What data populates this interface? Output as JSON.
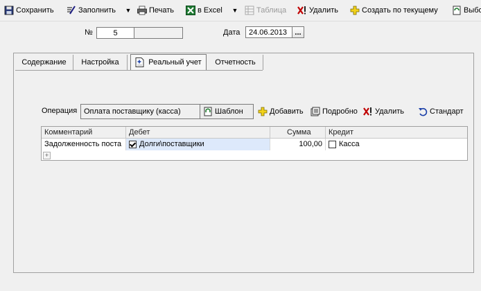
{
  "toolbar": {
    "save": "Сохранить",
    "fill": "Заполнить",
    "print": "Печать",
    "excel": "в Excel",
    "table": "Таблица",
    "delete": "Удалить",
    "create_from": "Создать по текущему",
    "select": "Выбо"
  },
  "header": {
    "number_label": "№",
    "number_value": "5",
    "date_label": "Дата",
    "date_value": "24.06.2013",
    "date_button": "..."
  },
  "tabs": [
    {
      "label": "Содержание"
    },
    {
      "label": "Настройка"
    },
    {
      "label": "Реальный учет"
    },
    {
      "label": "Отчетность"
    }
  ],
  "operation": {
    "label": "Операция",
    "value": "Оплата поставщику (касса)",
    "template_button": "Шаблон",
    "add_button": "Добавить",
    "detail_button": "Подробно",
    "delete_button": "Удалить",
    "standard_button": "Стандарт"
  },
  "grid": {
    "columns": [
      "Комментарий",
      "Дебет",
      "Сумма",
      "Кредит"
    ],
    "rows": [
      {
        "comment": "Задолженность поста",
        "debit": "Долги\\поставщики",
        "debit_checked": true,
        "amount": "100,00",
        "credit": "Касса",
        "credit_checked": false
      }
    ],
    "add_row_glyph": "+"
  },
  "colors": {
    "background": "#f0f0f0",
    "selection": "#dde9fb",
    "border": "#a0a0a0"
  }
}
